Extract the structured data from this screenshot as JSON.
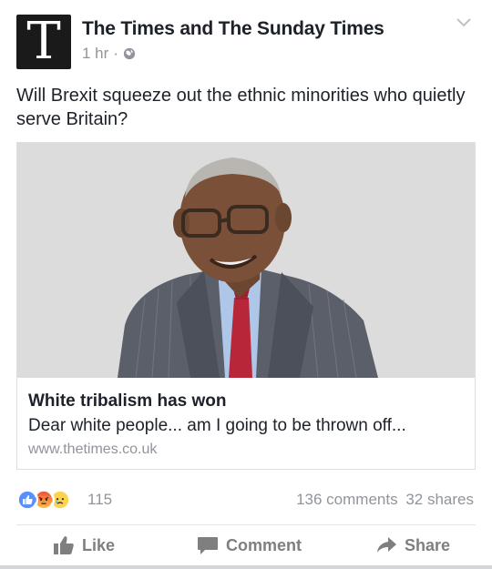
{
  "post": {
    "page_logo_letter": "T",
    "page_name": "The Times and The Sunday Times",
    "time": "1 hr",
    "separator": "·",
    "audience_icon": "globe-icon",
    "menu_icon": "chevron-down-icon",
    "text": "Will Brexit squeeze out the ethnic minorities who quietly serve Britain?"
  },
  "link_preview": {
    "image_subject": "portrait-photo",
    "title": "White tribalism has won",
    "description": "Dear white people... am I going to be thrown off...",
    "domain": "www.thetimes.co.uk"
  },
  "reactions": {
    "icons": [
      "like-reaction-icon",
      "angry-reaction-icon",
      "sad-reaction-icon"
    ],
    "count": "115",
    "comments": "136 comments",
    "shares": "32 shares"
  },
  "actions": {
    "like": "Like",
    "comment": "Comment",
    "share": "Share"
  },
  "colors": {
    "like_blue": "#5890ff",
    "angry_orange": "#f7714b",
    "sad_yellow": "#fcd34d",
    "meta_gray": "#90949c"
  }
}
